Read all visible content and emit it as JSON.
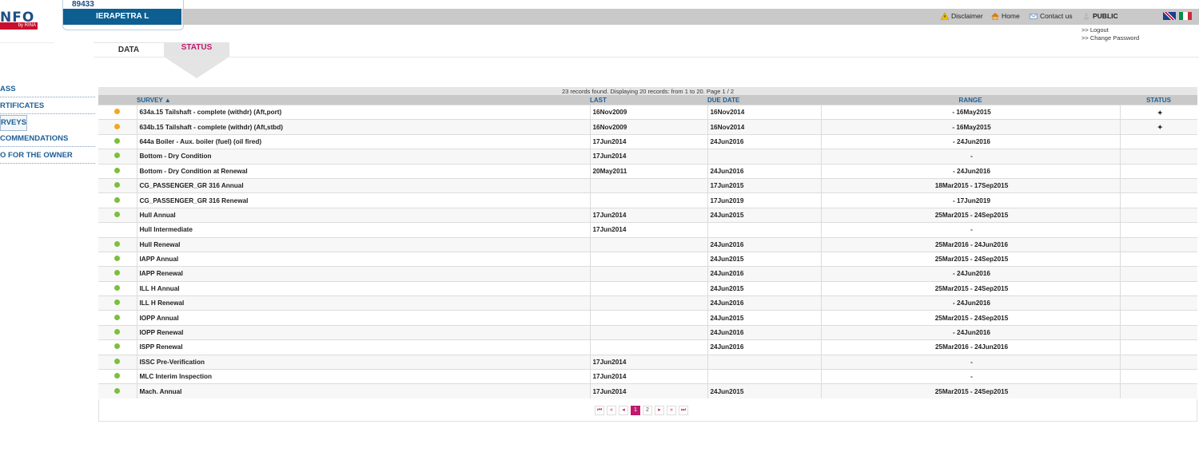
{
  "header": {
    "logo_text": "NFO",
    "logo_sub": "by RINA",
    "ship_number": "89433",
    "ship_name": "IERAPETRA L",
    "links": {
      "disclaimer": "Disclaimer",
      "home": "Home",
      "contact": "Contact us",
      "user": "PUBLIC"
    },
    "logout": ">> Logout",
    "change_password": ">> Change Password"
  },
  "tabs": {
    "data": "DATA",
    "status": "STATUS"
  },
  "menu": [
    "ASS",
    "RTIFICATES",
    "RVEYS",
    "COMMENDATIONS",
    "O FOR THE OWNER"
  ],
  "table": {
    "records_info": "23 records found. Displaying 20 records: from 1 to 20. Page 1 / 2",
    "headers": {
      "survey": "SURVEY ▲",
      "last": "LAST",
      "due": "DUE DATE",
      "range": "RANGE",
      "status": "STATUS"
    },
    "rows": [
      {
        "ind": "orange",
        "survey": "634a.15 Tailshaft - complete (withdr) (Aft,port)",
        "last": "16Nov2009",
        "due": "16Nov2014",
        "range": "- 16May2015",
        "status": "✦"
      },
      {
        "ind": "orange",
        "survey": "634b.15 Tailshaft - complete (withdr) (Aft,stbd)",
        "last": "16Nov2009",
        "due": "16Nov2014",
        "range": "- 16May2015",
        "status": "✦"
      },
      {
        "ind": "green",
        "survey": "644a Boiler - Aux. boiler (fuel) (oil fired)",
        "last": "17Jun2014",
        "due": "24Jun2016",
        "range": "- 24Jun2016",
        "status": ""
      },
      {
        "ind": "green",
        "survey": "Bottom - Dry Condition",
        "last": "17Jun2014",
        "due": "",
        "range": "-",
        "status": ""
      },
      {
        "ind": "green",
        "survey": "Bottom - Dry Condition at Renewal",
        "last": "20May2011",
        "due": "24Jun2016",
        "range": "- 24Jun2016",
        "status": ""
      },
      {
        "ind": "green",
        "survey": "CG_PASSENGER_GR 316 Annual",
        "last": "",
        "due": "17Jun2015",
        "range": "18Mar2015 - 17Sep2015",
        "status": ""
      },
      {
        "ind": "green",
        "survey": "CG_PASSENGER_GR 316 Renewal",
        "last": "",
        "due": "17Jun2019",
        "range": "- 17Jun2019",
        "status": ""
      },
      {
        "ind": "green",
        "survey": "Hull Annual",
        "last": "17Jun2014",
        "due": "24Jun2015",
        "range": "25Mar2015 - 24Sep2015",
        "status": ""
      },
      {
        "ind": "",
        "survey": "Hull Intermediate",
        "last": "17Jun2014",
        "due": "",
        "range": "-",
        "status": ""
      },
      {
        "ind": "green",
        "survey": "Hull Renewal",
        "last": "",
        "due": "24Jun2016",
        "range": "25Mar2016 - 24Jun2016",
        "status": ""
      },
      {
        "ind": "green",
        "survey": "IAPP Annual",
        "last": "",
        "due": "24Jun2015",
        "range": "25Mar2015 - 24Sep2015",
        "status": ""
      },
      {
        "ind": "green",
        "survey": "IAPP Renewal",
        "last": "",
        "due": "24Jun2016",
        "range": "- 24Jun2016",
        "status": ""
      },
      {
        "ind": "green",
        "survey": "ILL H Annual",
        "last": "",
        "due": "24Jun2015",
        "range": "25Mar2015 - 24Sep2015",
        "status": ""
      },
      {
        "ind": "green",
        "survey": "ILL H Renewal",
        "last": "",
        "due": "24Jun2016",
        "range": "- 24Jun2016",
        "status": ""
      },
      {
        "ind": "green",
        "survey": "IOPP Annual",
        "last": "",
        "due": "24Jun2015",
        "range": "25Mar2015 - 24Sep2015",
        "status": ""
      },
      {
        "ind": "green",
        "survey": "IOPP Renewal",
        "last": "",
        "due": "24Jun2016",
        "range": "- 24Jun2016",
        "status": ""
      },
      {
        "ind": "green",
        "survey": "ISPP Renewal",
        "last": "",
        "due": "24Jun2016",
        "range": "25Mar2016 - 24Jun2016",
        "status": ""
      },
      {
        "ind": "green",
        "survey": "ISSC Pre-Verification",
        "last": "17Jun2014",
        "due": "",
        "range": "-",
        "status": ""
      },
      {
        "ind": "green",
        "survey": "MLC Interim Inspection",
        "last": "17Jun2014",
        "due": "",
        "range": "-",
        "status": ""
      },
      {
        "ind": "green",
        "survey": "Mach. Annual",
        "last": "17Jun2014",
        "due": "24Jun2015",
        "range": "25Mar2015 - 24Sep2015",
        "status": ""
      }
    ]
  },
  "pager": {
    "first": "⏮",
    "prev_block": "«",
    "prev": "◂",
    "pages": [
      "1",
      "2"
    ],
    "next": "▸",
    "next_block": "»",
    "last": "⏭"
  },
  "colors": {
    "orange": "#f5a623",
    "green": "#7cbf3b",
    "accent": "#c01a6e",
    "link": "#1d5f96"
  }
}
